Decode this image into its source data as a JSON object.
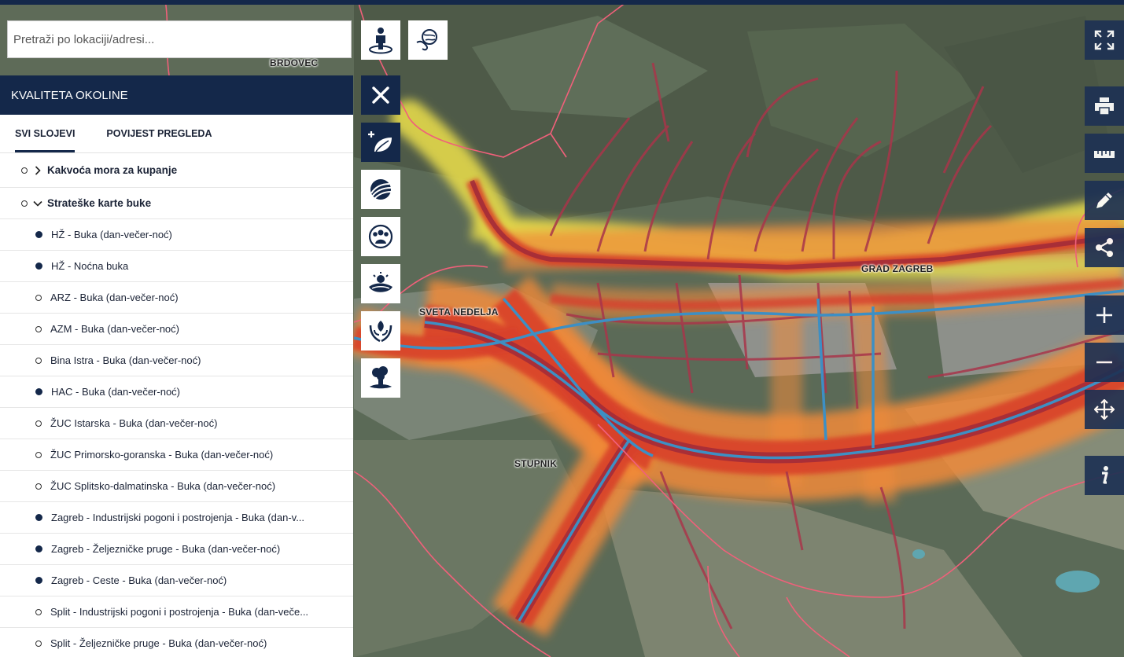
{
  "search": {
    "placeholder": "Pretraži po lokaciji/adresi..."
  },
  "map": {
    "place_labels": [
      "BRDOVEC",
      "SVETA NEDELJA",
      "STUPNIK",
      "GRAD ZAGREB"
    ]
  },
  "panel": {
    "title": "KVALITETA OKOLINE",
    "tabs": [
      {
        "label": "SVI SLOJEVI",
        "active": true
      },
      {
        "label": "POVIJEST PREGLEDA",
        "active": false
      }
    ],
    "groups": [
      {
        "label": "Kakvoća mora za kupanje",
        "expanded": false
      },
      {
        "label": "Strateške karte buke",
        "expanded": true
      }
    ],
    "layers": [
      {
        "label": "HŽ - Buka (dan-večer-noć)",
        "active": true
      },
      {
        "label": "HŽ - Noćna buka",
        "active": true
      },
      {
        "label": "ARZ - Buka (dan-večer-noć)",
        "active": false
      },
      {
        "label": "AZM - Buka (dan-večer-noć)",
        "active": false
      },
      {
        "label": "Bina Istra - Buka (dan-večer-noć)",
        "active": false
      },
      {
        "label": "HAC - Buka (dan-večer-noć)",
        "active": true
      },
      {
        "label": "ŽUC Istarska - Buka (dan-večer-noć)",
        "active": false
      },
      {
        "label": "ŽUC Primorsko-goranska - Buka (dan-večer-noć)",
        "active": false
      },
      {
        "label": "ŽUC Splitsko-dalmatinska - Buka (dan-večer-noć)",
        "active": false
      },
      {
        "label": "Zagreb - Industrijski pogoni i postrojenja - Buka (dan-v...",
        "active": true
      },
      {
        "label": "Zagreb - Željezničke pruge - Buka (dan-večer-noć)",
        "active": true
      },
      {
        "label": "Zagreb - Ceste - Buka (dan-večer-noć)",
        "active": true
      },
      {
        "label": "Split - Industrijski pogoni i postrojenja - Buka (dan-veče...",
        "active": false
      },
      {
        "label": "Split - Željezničke pruge - Buka (dan-večer-noć)",
        "active": false
      }
    ]
  },
  "colors": {
    "navy": "#14284a",
    "noise_yellow": "#e3d84a",
    "noise_orange": "#f08a3a",
    "noise_red": "#d8402a",
    "noise_darkred": "#a02a3a",
    "road_blue": "#3d8fc4",
    "boundary": "#f0607a"
  },
  "icons": {
    "left_tools": [
      "street-view-icon",
      "globe-hand-icon",
      "close-icon",
      "add-environment-icon",
      "agriculture-icon",
      "population-icon",
      "landscape-icon",
      "nature-protection-icon",
      "pollution-icon"
    ],
    "right_tools": [
      "fullscreen-icon",
      "print-icon",
      "measure-ruler-icon",
      "draw-pencil-icon",
      "share-icon",
      "zoom-in-icon",
      "zoom-out-icon",
      "pan-icon",
      "info-icon"
    ]
  }
}
